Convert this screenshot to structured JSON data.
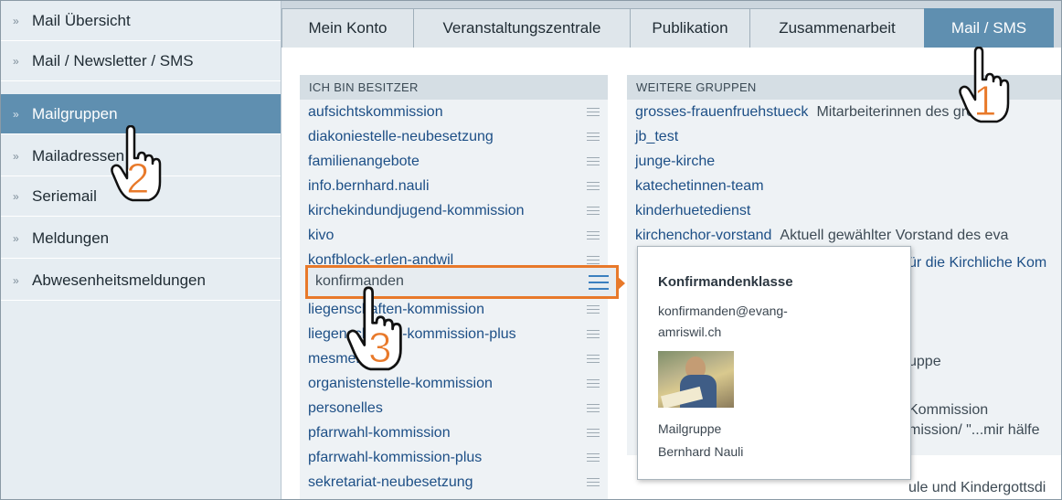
{
  "sidebar": {
    "items": [
      {
        "label": "Mail Übersicht"
      },
      {
        "label": "Mail / Newsletter / SMS"
      },
      {
        "label": "Mailgruppen"
      },
      {
        "label": "Mailadressen"
      },
      {
        "label": "Seriemail"
      },
      {
        "label": "Meldungen"
      },
      {
        "label": "Abwesenheitsmeldungen"
      }
    ]
  },
  "tabs": [
    {
      "label": "Mein Konto"
    },
    {
      "label": "Veranstaltungszentrale"
    },
    {
      "label": "Publikation"
    },
    {
      "label": "Zusammenarbeit"
    },
    {
      "label": "Mail / SMS"
    }
  ],
  "owner_panel": {
    "heading": "ICH BIN BESITZER",
    "groups": [
      {
        "name": "aufsichtskommission"
      },
      {
        "name": "diakoniestelle-neubesetzung"
      },
      {
        "name": "familienangebote"
      },
      {
        "name": "info.bernhard.nauli"
      },
      {
        "name": "kirchekindundjugend-kommission"
      },
      {
        "name": "kivo"
      },
      {
        "name": "konfblock-erlen-andwil"
      },
      {
        "name": "konfirmanden"
      },
      {
        "name": "liegenschaften-kommission"
      },
      {
        "name": "liegenschaften-kommission-plus"
      },
      {
        "name": "mesmer"
      },
      {
        "name": "organistenstelle-kommission"
      },
      {
        "name": "personelles"
      },
      {
        "name": "pfarrwahl-kommission"
      },
      {
        "name": "pfarrwahl-kommission-plus"
      },
      {
        "name": "sekretariat-neubesetzung"
      }
    ]
  },
  "other_panel": {
    "heading": "WEITERE GRUPPEN",
    "groups": [
      {
        "name": "grosses-frauenfruehstueck",
        "desc": "Mitarbeiterinnen des grossen"
      },
      {
        "name": "jb_test",
        "desc": ""
      },
      {
        "name": "junge-kirche",
        "desc": ""
      },
      {
        "name": "katechetinnen-team",
        "desc": ""
      },
      {
        "name": "kinderhuetedienst",
        "desc": ""
      },
      {
        "name": "kirchenchor-vorstand",
        "desc": "Aktuell gewählter Vorstand des eva"
      }
    ],
    "partial_fragments": [
      "ür die Kirchliche Kom",
      "uppe",
      "Kommission",
      "mission/ \"...mir hälfe",
      "ule und Kindergottsdi"
    ]
  },
  "popup": {
    "title": "Konfirmandenklasse",
    "email_line1": "konfirmanden@evang-",
    "email_line2": "amriswil.ch",
    "type": "Mailgruppe",
    "owner": "Bernhard Nauli"
  },
  "annotations": {
    "step1": "1",
    "step2": "2",
    "step3": "3",
    "accent_color": "#e8792a"
  },
  "colors": {
    "active_nav": "#5f8fb0",
    "link": "#1d4f86"
  }
}
